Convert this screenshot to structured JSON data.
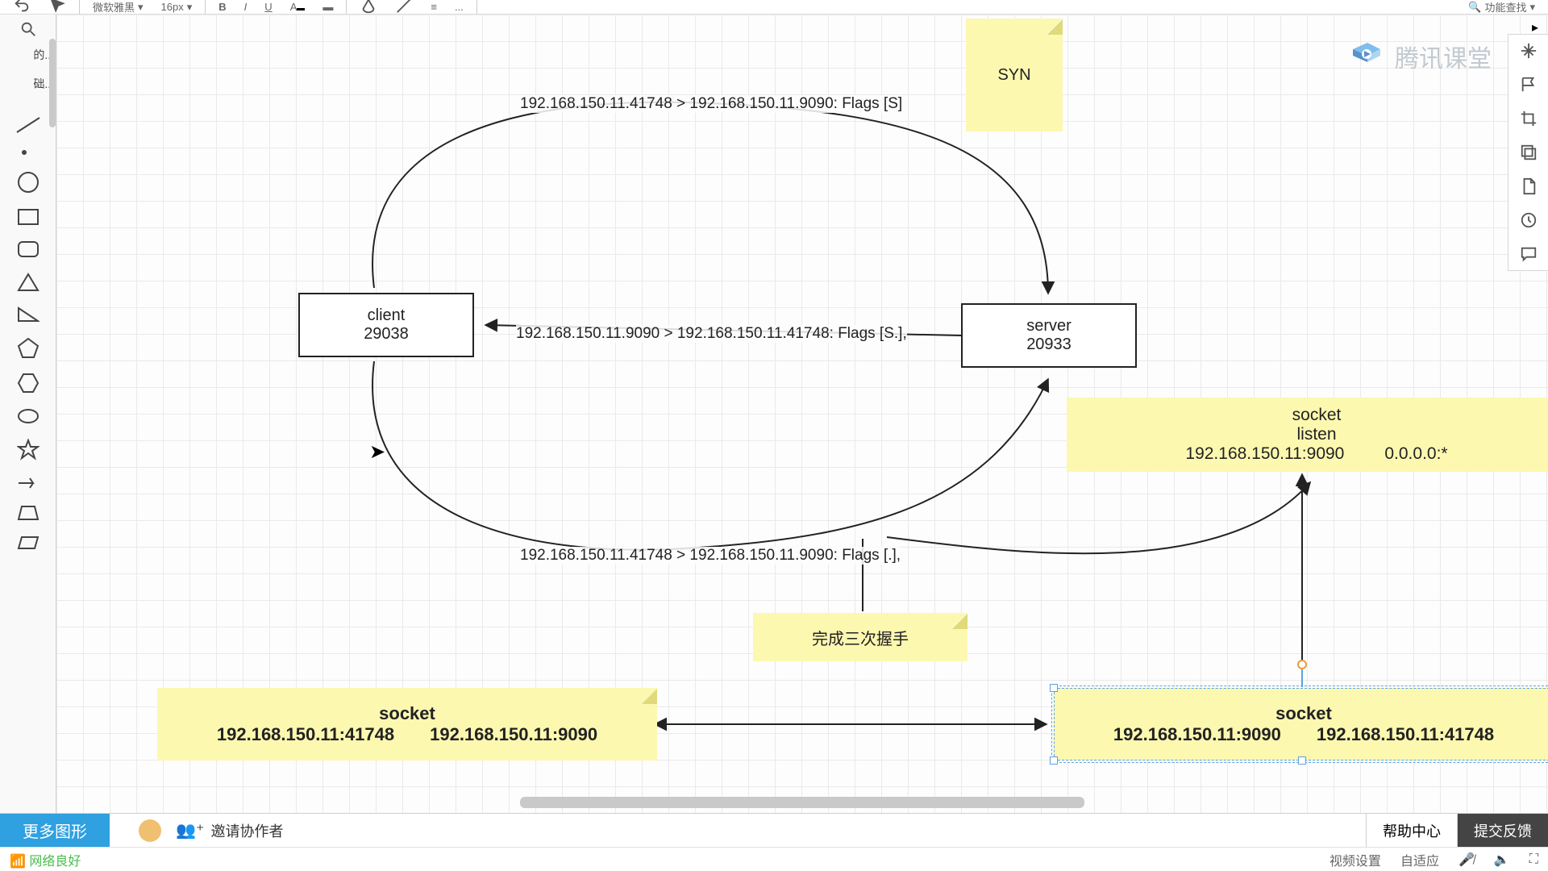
{
  "toolbar": {
    "font": "微软雅黑",
    "fontsize": "16px",
    "smart": "功能查找"
  },
  "leftpanel": {
    "cat1": "的...",
    "cat2": "础..."
  },
  "diagram": {
    "client": {
      "line1": "client",
      "line2": "29038"
    },
    "server": {
      "line1": "server",
      "line2": "20933"
    },
    "syn_note": "SYN",
    "listen_note": {
      "line1": "socket",
      "line2": "listen",
      "addr1": "192.168.150.11:9090",
      "addr2": "0.0.0.0:*"
    },
    "handshake_note": "完成三次握手",
    "edge_syn": "192.168.150.11.41748 > 192.168.150.11.9090: Flags [S]",
    "edge_synack": "192.168.150.11.9090 > 192.168.150.11.41748: Flags [S.],",
    "edge_ack": "192.168.150.11.41748 > 192.168.150.11.9090: Flags [.],",
    "socket_left": {
      "title": "socket",
      "a1": "192.168.150.11:41748",
      "a2": "192.168.150.11:9090"
    },
    "socket_right": {
      "title": "socket",
      "a1": "192.168.150.11:9090",
      "a2": "192.168.150.11:41748"
    }
  },
  "watermark": "腾讯课堂",
  "morebar": {
    "more": "更多图形",
    "invite": "邀请协作者",
    "help": "帮助中心",
    "feedback": "提交反馈"
  },
  "statusbar": {
    "net": "网络良好",
    "video": "视频设置",
    "adapt": "自适应"
  }
}
